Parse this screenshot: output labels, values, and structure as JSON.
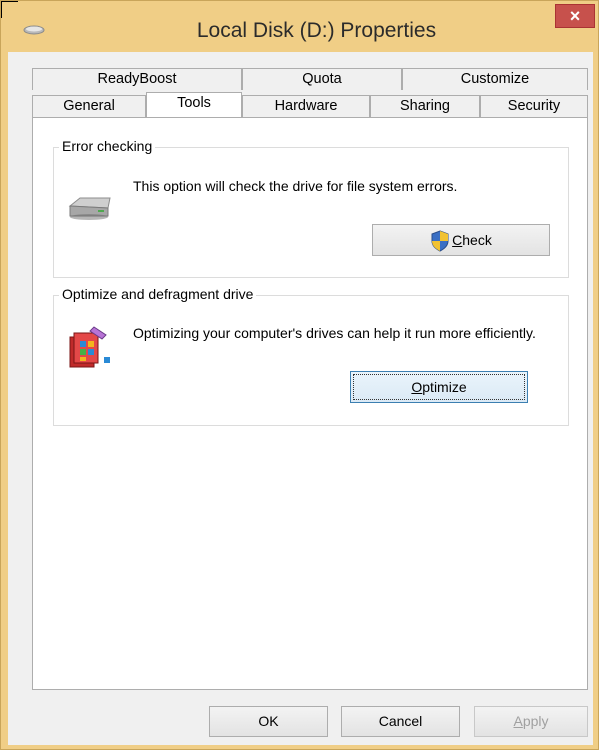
{
  "window": {
    "title": "Local Disk (D:) Properties",
    "close_label": "×"
  },
  "tabs": {
    "row1": [
      "ReadyBoost",
      "Quota",
      "Customize"
    ],
    "row2": [
      "General",
      "Tools",
      "Hardware",
      "Sharing",
      "Security"
    ],
    "active": "Tools"
  },
  "error_checking": {
    "label": "Error checking",
    "description": "This option will check the drive for file system errors.",
    "check_button": "Check",
    "check_mnemonic": "C",
    "check_rest": "heck"
  },
  "optimize": {
    "label": "Optimize and defragment drive",
    "description": "Optimizing your computer's drives can help it run more efficiently.",
    "optimize_mnemonic": "O",
    "optimize_rest": "ptimize"
  },
  "footer": {
    "ok": "OK",
    "cancel": "Cancel",
    "apply_mnemonic": "A",
    "apply_rest": "pply"
  },
  "colors": {
    "frame": "#f0ce86",
    "close_button": "#c7514c",
    "focus_border": "#3c7fb1"
  }
}
